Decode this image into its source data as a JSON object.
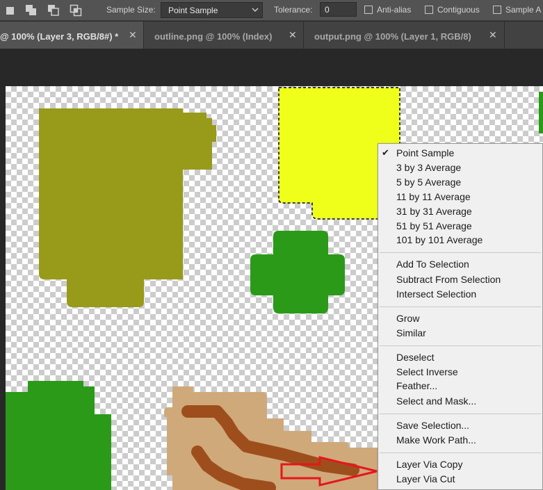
{
  "options_bar": {
    "sample_size_label": "Sample Size:",
    "sample_size_value": "Point Sample",
    "tolerance_label": "Tolerance:",
    "tolerance_value": "0",
    "anti_alias_label": "Anti-alias",
    "contiguous_label": "Contiguous",
    "sample_all_label": "Sample A"
  },
  "tabs": [
    {
      "label": "@ 100% (Layer 3, RGB/8#) *",
      "close": "✕"
    },
    {
      "label": "outline.png @ 100% (Index)",
      "close": "✕"
    },
    {
      "label": "output.png @ 100% (Layer 1, RGB/8)",
      "close": "✕"
    }
  ],
  "context_menu": {
    "check_mark": "✔",
    "groups": [
      [
        "Point Sample",
        "3 by 3 Average",
        "5 by 5 Average",
        "11 by 11 Average",
        "31 by 31 Average",
        "51 by 51 Average",
        "101 by 101 Average"
      ],
      [
        "Add To Selection",
        "Subtract From Selection",
        "Intersect Selection"
      ],
      [
        "Grow",
        "Similar"
      ],
      [
        "Deselect",
        "Select Inverse",
        "Feather...",
        "Select and Mask..."
      ],
      [
        "Save Selection...",
        "Make Work Path..."
      ],
      [
        "Layer Via Copy",
        "Layer Via Cut"
      ]
    ]
  },
  "colors": {
    "olive": "#989a1a",
    "yellow": "#f0ff1a",
    "green": "#2a9a18",
    "tan": "#cfa97a",
    "brown": "#9e4e1c",
    "arrow": "#e8141c"
  }
}
